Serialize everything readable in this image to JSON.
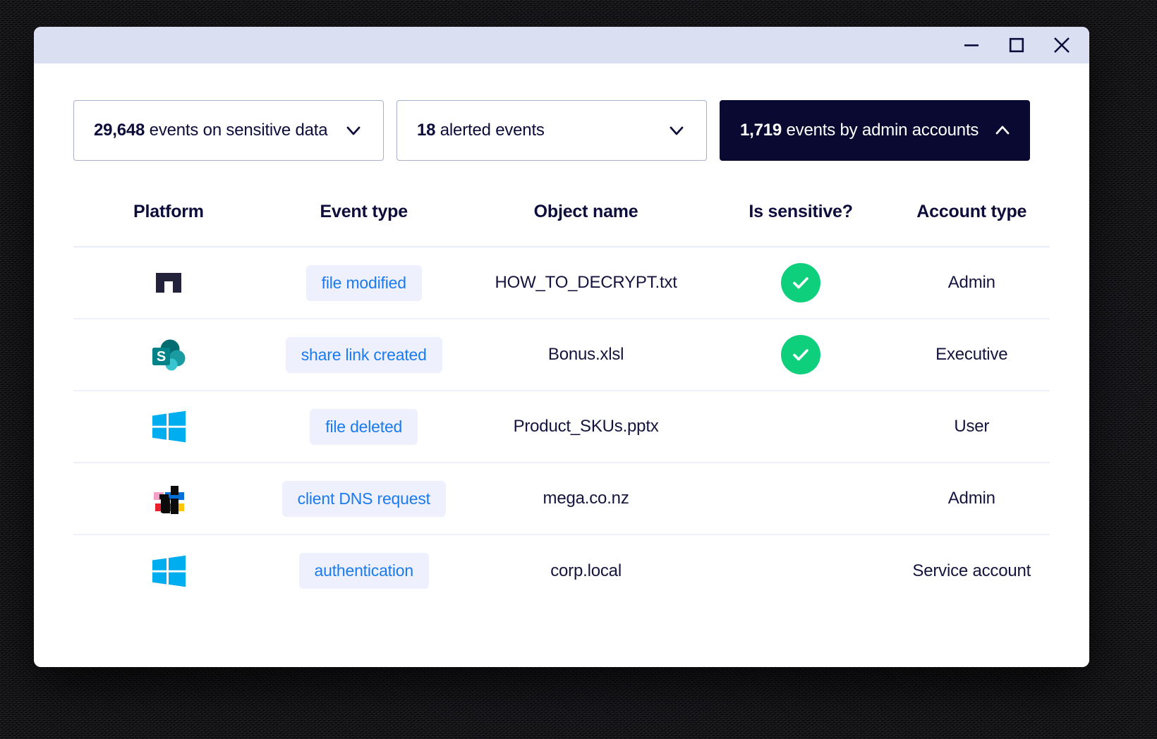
{
  "window": {
    "controls": [
      {
        "name": "minimize",
        "label": "Minimize"
      },
      {
        "name": "maximize",
        "label": "Maximize"
      },
      {
        "name": "close",
        "label": "Close"
      }
    ]
  },
  "filters": [
    {
      "count": "29,648",
      "text": " events on sensitive data",
      "state": "collapsed",
      "chevron": "chevron-down-icon",
      "selected": false
    },
    {
      "count": "18",
      "text": " alerted events",
      "state": "collapsed",
      "chevron": "chevron-down-icon",
      "selected": false
    },
    {
      "count": "1,719",
      "text": " events by admin accounts",
      "state": "expanded",
      "chevron": "chevron-up-icon",
      "selected": true
    }
  ],
  "table": {
    "headers": [
      "Platform",
      "Event type",
      "Object name",
      "Is sensitive?",
      "Account type"
    ],
    "rows": [
      {
        "platform_icon": "netdocuments-logo-icon",
        "event_type": "file modified",
        "object_name": "HOW_TO_DECRYPT.txt",
        "is_sensitive": true,
        "account_type": "Admin"
      },
      {
        "platform_icon": "sharepoint-logo-icon",
        "event_type": "share link created",
        "object_name": "Bonus.xlsl",
        "is_sensitive": true,
        "account_type": "Executive"
      },
      {
        "platform_icon": "windows-logo-icon",
        "event_type": "file deleted",
        "object_name": "Product_SKUs.pptx",
        "is_sensitive": false,
        "account_type": "User"
      },
      {
        "platform_icon": "cisco-umbrella-logo-icon",
        "event_type": "client DNS request",
        "object_name": "mega.co.nz",
        "is_sensitive": false,
        "account_type": "Admin"
      },
      {
        "platform_icon": "windows-logo-icon",
        "event_type": "authentication",
        "object_name": "corp.local",
        "is_sensitive": false,
        "account_type": "Service account"
      }
    ]
  },
  "colors": {
    "titlebar": "#dadff2",
    "dark_pill_bg": "#090932",
    "pill_border": "#a9b0cf",
    "tag_bg": "#eef1fd",
    "tag_text": "#1a7af0",
    "check_green": "#0ed07c",
    "text_navy": "#0d0d3c",
    "row_divider": "#eef1fb",
    "windows_blue": "#00adef",
    "sharepoint_teal": "#0f7b7b"
  }
}
